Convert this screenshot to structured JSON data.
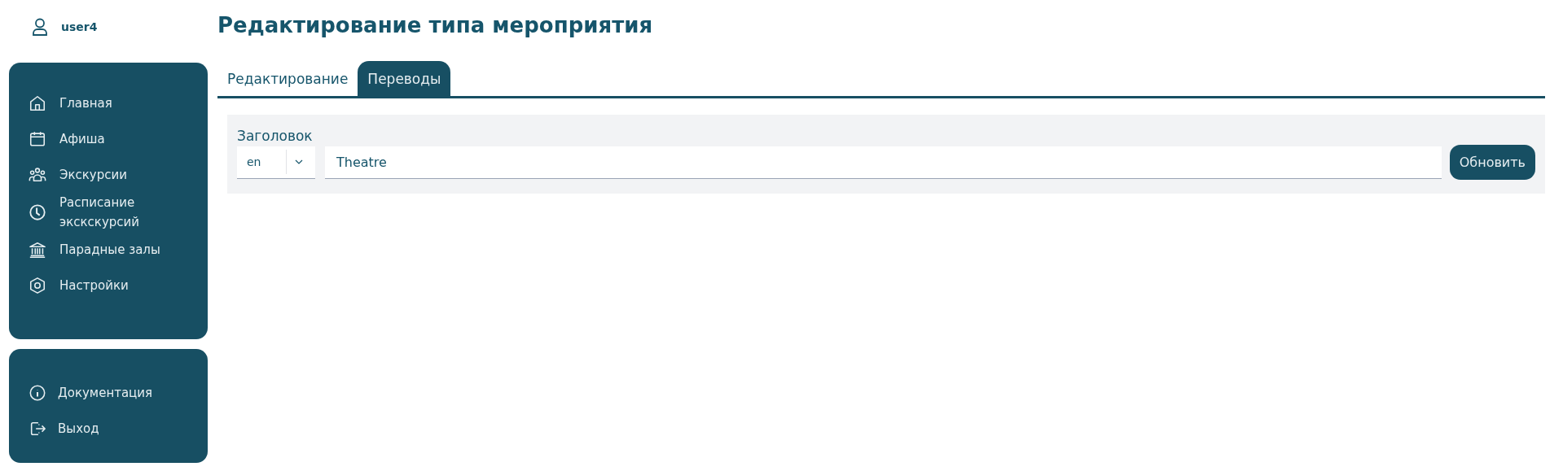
{
  "user": {
    "name": "user4"
  },
  "nav": [
    {
      "label": "Главная"
    },
    {
      "label": "Афиша"
    },
    {
      "label": "Экскурсии"
    },
    {
      "label": "Расписание экскскурсий"
    },
    {
      "label": "Парадные залы"
    },
    {
      "label": "Настройки"
    }
  ],
  "nav_bottom": [
    {
      "label": "Документация"
    },
    {
      "label": "Выход"
    }
  ],
  "title": "Редактирование типа мероприятия",
  "tabs": [
    {
      "label": "Редактирование",
      "selected": false
    },
    {
      "label": "Переводы",
      "selected": true
    }
  ],
  "form": {
    "label": "Заголовок",
    "language": "en",
    "value": "Theatre",
    "button": "Обновить"
  }
}
